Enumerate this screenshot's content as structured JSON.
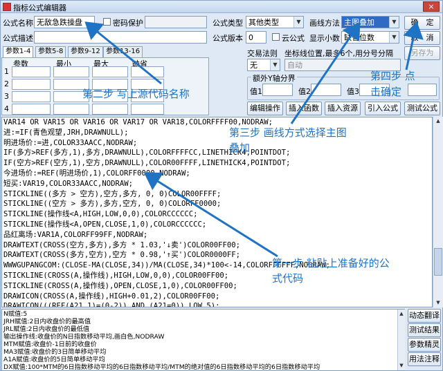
{
  "window": {
    "title": "指标公式编辑器",
    "close": "×"
  },
  "form": {
    "name_label": "公式名称",
    "name_value": "无敌急跌操盘",
    "password_label": "密码保护",
    "desc_label": "公式描述",
    "type_label": "公式类型",
    "type_value": "其他类型",
    "draw_label": "画线方法",
    "draw_value": "主图叠加",
    "version_label": "公式版本",
    "version_value": "0",
    "cloud_label": "云公式",
    "decimals_label": "显示小数",
    "decimals_value": "缺省位数",
    "trade_rule_label": "交易法则",
    "coord_label": "坐标线位置,最多6个,用分号分隔",
    "trade_value": "无",
    "coord_value": "自动",
    "yaxis_label": "额外Y轴分界",
    "val1": "值1",
    "val2": "值2",
    "val3": "值3"
  },
  "tabs": [
    "参数1-4",
    "参数5-8",
    "参数9-12",
    "参数13-16"
  ],
  "params": {
    "headers": [
      "参数",
      "最小",
      "最大",
      "缺省"
    ],
    "rows": [
      "1",
      "2",
      "3",
      "4"
    ]
  },
  "buttons": {
    "ok": "确　定",
    "cancel": "取　消",
    "saveas": "另存为",
    "edit": "编辑操作",
    "insert_func": "插入函数",
    "insert_res": "插入资源",
    "import": "引入公式",
    "test": "测试公式",
    "dynamic_translate": "动态翻译",
    "test_result": "测试结果",
    "param_refine": "参数精灵",
    "usage_note": "用法注释"
  },
  "code_lines": [
    "VAR14 OR VAR15 OR VAR16 OR VAR17 OR VAR18,COLORFFFF00,NODRAW;",
    "进:=IF(青色观望,JRH,DRAWNULL);",
    "明进场价:=进,COLOR33AACC,NODRAW;",
    "IF(多方>REF(多方,1),多方,DRAWNULL),COLORFFFFCC,LINETHICK4,POINTDOT;",
    "IF(空方>REF(空方,1),空方,DRAWNULL),COLOR00FFFF,LINETHICK4,POINTDOT;",
    "今进场价:=REF(明进场价,1),COLORFF0000,NODRAW;",
    "短买:VAR19,COLOR33AACC,NODRAW;",
    "STICKLINE((多方 > 空方),空方,多方, 0, 0)COLOR00FFFF;",
    "STICKLINE((空方 > 多方),多方,空方, 0, 0)COLORFF0000;",
    "STICKLINE(操作线<A,HIGH,LOW,0,0),COLORCCCCCC;",
    "STICKLINE(操作线<A,OPEN,CLOSE,1,0),COLORCCCCCC;",
    "品红离场:VAR1A,COLORFF99FF,NODRAW;",
    "DRAWTEXT(CROSS(空方,多方),多方 * 1.03,'↓卖')COLOR00FF00;",
    "DRAWTEXT(CROSS(多方,空方),空方 * 0.98,'↑买')COLOR0000FF;",
    "WWWGUPANGCOM:(CLOSE-MA(CLOSE,34))/MA(CLOSE,34)*100<-14,COLORFFFFFF,NODRAW;",
    "STICKLINE(CROSS(A,操作线),HIGH,LOW,0,0),COLOR00FF00;",
    "STICKLINE(CROSS(A,操作线),OPEN,CLOSE,1,0),COLOR00FF00;",
    "DRAWICON(CROSS(A,操作线),HIGH+0.01,2),COLOR00FF00;",
    "DRAWICON(((REF(A21,1)=(0-2)) AND (A21=0)),LOW,5);",
    "DRAWICON(((REF(A1E,1)>0) AND (A1E=0)),HIGH,6);"
  ],
  "desc_lines": [
    "N赋值:5",
    "JRH赋值:2日内收盘价的最高值",
    "JRL赋值:2日内收盘价的最低值",
    "输出操作线:收盘价的N日指数移动平均,画白色,NODRAW",
    "MTM赋值:收盘价-1日前的收盘价",
    "MA3赋值:收盘价的3日简单移动平均",
    "A1A赋值:收盘价的5日简单移动平均",
    "DX赋值:100*MTM的6日指数移动平均的6日指数移动平均/MTM的绝对值的6日指数移动平均的6日指数移动平均"
  ],
  "annotations": {
    "step1": "第一步 粘贴上准备好的公",
    "step1b": "式代码",
    "step2": "第二步 写上源代码名称",
    "step3": "第三步 画线方式选择主图",
    "step3b": "叠加",
    "step4": "第四步 点",
    "step4b": "击确定"
  },
  "colors": {
    "annotation": "#1e73c4",
    "code_keyword": "#000080",
    "selection": "#316ac5"
  }
}
